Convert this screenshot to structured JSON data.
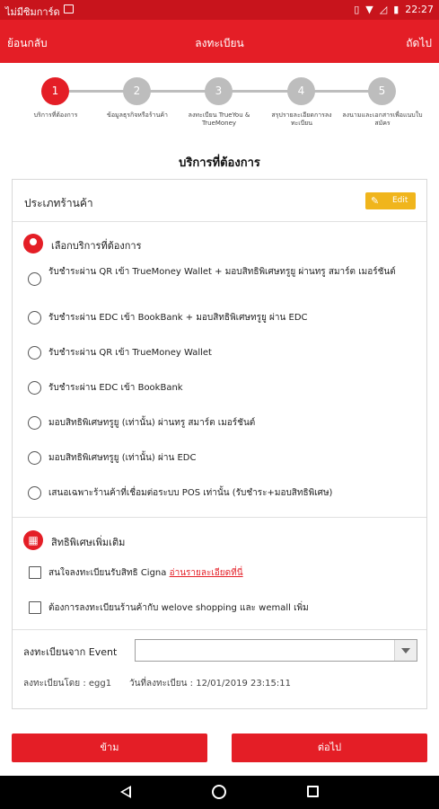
{
  "status_bar": {
    "carrier": "ไม่มีซิมการ์ด",
    "time": "22:27",
    "icons": [
      "image-icon",
      "vibrate-icon",
      "wifi-icon",
      "no-signal-icon",
      "battery-icon"
    ],
    "background": "#c8141c"
  },
  "toolbar": {
    "back_label": "ย้อนกลับ",
    "title": "ลงทะเบียน",
    "next_label": "ถัดไป",
    "background": "#e41e26"
  },
  "stepper": {
    "active_index": 0,
    "active_color": "#e41e26",
    "inactive_color": "#bdbdbd",
    "steps": [
      {
        "number": "1",
        "label": "บริการที่ต้องการ"
      },
      {
        "number": "2",
        "label": "ข้อมูลธุรกิจหรือร้านค้า"
      },
      {
        "number": "3",
        "label": "ลงทะเบียน TrueYou & TrueMoney"
      },
      {
        "number": "4",
        "label": "สรุปรายละเอียดการลงทะเบียน"
      },
      {
        "number": "5",
        "label": "ลงนามและเอกสารเพื่อแนบใบสมัคร"
      }
    ]
  },
  "section_title": "บริการที่ต้องการ",
  "card": {
    "store_type_label": "ประเภทร้านค้า",
    "edit_label": "Edit",
    "services_heading": "เลือกบริการที่ต้องการ",
    "services": [
      {
        "label": "รับชำระผ่าน QR เข้า TrueMoney Wallet + มอบสิทธิพิเศษทรูยู ผ่านทรู สมาร์ต เมอร์ชันต์",
        "selected": false
      },
      {
        "label": "รับชำระผ่าน EDC เข้า BookBank + มอบสิทธิพิเศษทรูยู ผ่าน EDC",
        "selected": false
      },
      {
        "label": "รับชำระผ่าน QR เข้า TrueMoney Wallet",
        "selected": false
      },
      {
        "label": "รับชำระผ่าน EDC เข้า BookBank",
        "selected": false
      },
      {
        "label": "มอบสิทธิพิเศษทรูยู (เท่านั้น) ผ่านทรู สมาร์ต เมอร์ชันต์",
        "selected": false
      },
      {
        "label": "มอบสิทธิพิเศษทรูยู (เท่านั้น) ผ่าน EDC",
        "selected": false
      },
      {
        "label": "เสนอเฉพาะร้านค้าที่เชื่อมต่อระบบ POS เท่านั้น (รับชำระ+มอบสิทธิพิเศษ)",
        "selected": false
      }
    ],
    "extras_heading": "สิทธิพิเศษเพิ่มเติม",
    "extras": [
      {
        "label": "สนใจลงทะเบียนรับสิทธิ Cigna ",
        "link": "อ่านรายละเอียดที่นี่",
        "checked": false
      },
      {
        "label": "ต้องการลงทะเบียนร้านค้ากับ welove shopping และ wemall เพิ่ม",
        "link": "",
        "checked": false
      }
    ],
    "event_label": "ลงทะเบียนจาก Event",
    "event_value": "",
    "registered_by": "ลงทะเบียนโดย : egg1",
    "registered_date": "วันที่ลงทะเบียน : 12/01/2019 23:15:11"
  },
  "buttons": {
    "skip_label": "ข้าม",
    "next_label": "ต่อไป",
    "color": "#e41e26"
  },
  "nav_bar": {
    "icons": [
      "back-icon",
      "home-icon",
      "recent-apps-icon"
    ]
  }
}
